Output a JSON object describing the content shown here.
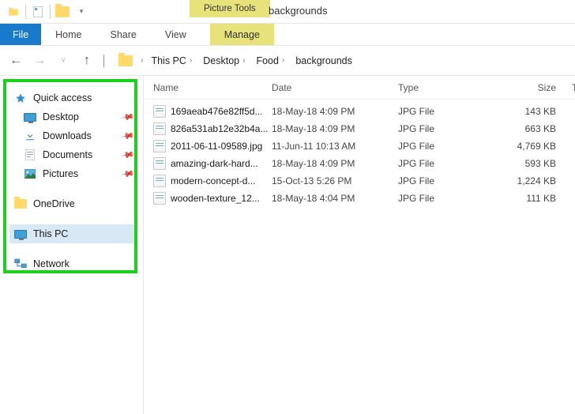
{
  "titlebar": {
    "context_tab": "Picture Tools",
    "title": "backgrounds"
  },
  "ribbon": {
    "file": "File",
    "home": "Home",
    "share": "Share",
    "view": "View",
    "manage": "Manage"
  },
  "breadcrumbs": {
    "items": [
      "This PC",
      "Desktop",
      "Food",
      "backgrounds"
    ]
  },
  "tree": {
    "quick_access": "Quick access",
    "desktop": "Desktop",
    "downloads": "Downloads",
    "documents": "Documents",
    "pictures": "Pictures",
    "onedrive": "OneDrive",
    "this_pc": "This PC",
    "network": "Network"
  },
  "columns": {
    "name": "Name",
    "date": "Date",
    "type": "Type",
    "size": "Size",
    "extra": "T"
  },
  "files": [
    {
      "name": "169aeab476e82ff5d...",
      "date": "18-May-18 4:09 PM",
      "type": "JPG File",
      "size": "143 KB"
    },
    {
      "name": "826a531ab12e32b4a...",
      "date": "18-May-18 4:09 PM",
      "type": "JPG File",
      "size": "663 KB"
    },
    {
      "name": "2011-06-11-09589.jpg",
      "date": "11-Jun-11 10:13 AM",
      "type": "JPG File",
      "size": "4,769 KB"
    },
    {
      "name": "amazing-dark-hard...",
      "date": "18-May-18 4:09 PM",
      "type": "JPG File",
      "size": "593 KB"
    },
    {
      "name": "modern-concept-d...",
      "date": "15-Oct-13 5:26 PM",
      "type": "JPG File",
      "size": "1,224 KB"
    },
    {
      "name": "wooden-texture_12...",
      "date": "18-May-18 4:04 PM",
      "type": "JPG File",
      "size": "111 KB"
    }
  ]
}
